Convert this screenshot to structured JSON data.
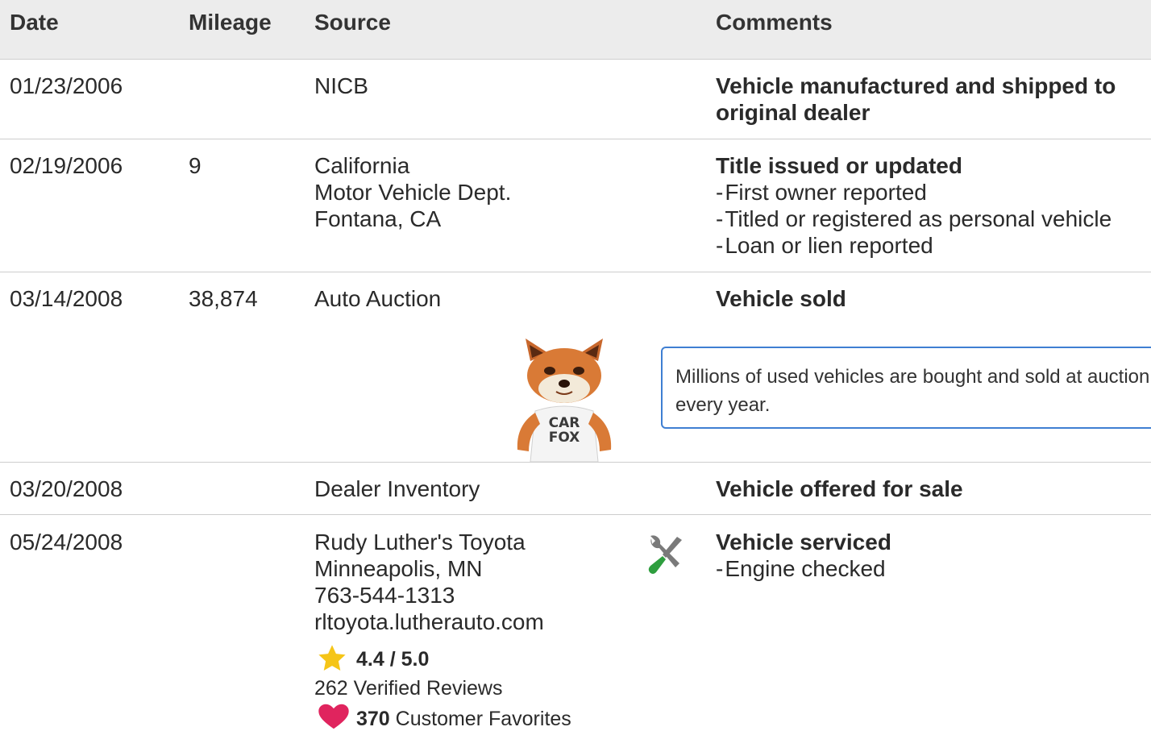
{
  "header": {
    "date": "Date",
    "mileage": "Mileage",
    "source": "Source",
    "comments": "Comments"
  },
  "rows": [
    {
      "date": "01/23/2006",
      "mileage": "",
      "source": [
        "NICB"
      ],
      "comment_title": "Vehicle manufactured and shipped to",
      "comment_title_2": "original dealer",
      "bullets": []
    },
    {
      "date": "02/19/2006",
      "mileage": "9",
      "source": [
        "California",
        "Motor Vehicle Dept.",
        "Fontana, CA"
      ],
      "comment_title": "Title issued or updated",
      "bullets": [
        "First owner reported",
        "Titled or registered as personal vehicle",
        "Loan or lien reported"
      ]
    },
    {
      "date": "03/14/2008",
      "mileage": "38,874",
      "source": [
        "Auto Auction"
      ],
      "comment_title": "Vehicle sold",
      "bullets": []
    },
    {
      "date": "03/20/2008",
      "mileage": "",
      "source": [
        "Dealer Inventory"
      ],
      "comment_title": "Vehicle offered for sale",
      "bullets": []
    },
    {
      "date": "05/24/2008",
      "mileage": "",
      "source": [
        "Rudy Luther's Toyota",
        "Minneapolis, MN",
        "763-544-1313",
        "rltoyota.lutherauto.com"
      ],
      "comment_title": "Vehicle serviced",
      "bullets": [
        "Engine checked"
      ],
      "rating": "4.4 / 5.0",
      "reviews": "262 Verified Reviews",
      "favorites_count": "370",
      "favorites_label": "Customer Favorites"
    }
  ],
  "callout": {
    "text": "Millions of used vehicles are bought and sold at auction every year."
  },
  "fox_shirt_line1": "CAR",
  "fox_shirt_line2": "FOX",
  "icons": {
    "star": "star-icon",
    "heart": "heart-icon",
    "service": "wrench-screwdriver-icon"
  },
  "colors": {
    "star": "#f5c518",
    "heart": "#e0245e",
    "callout_border": "#3f7fd2",
    "header_bg": "#ececec"
  }
}
